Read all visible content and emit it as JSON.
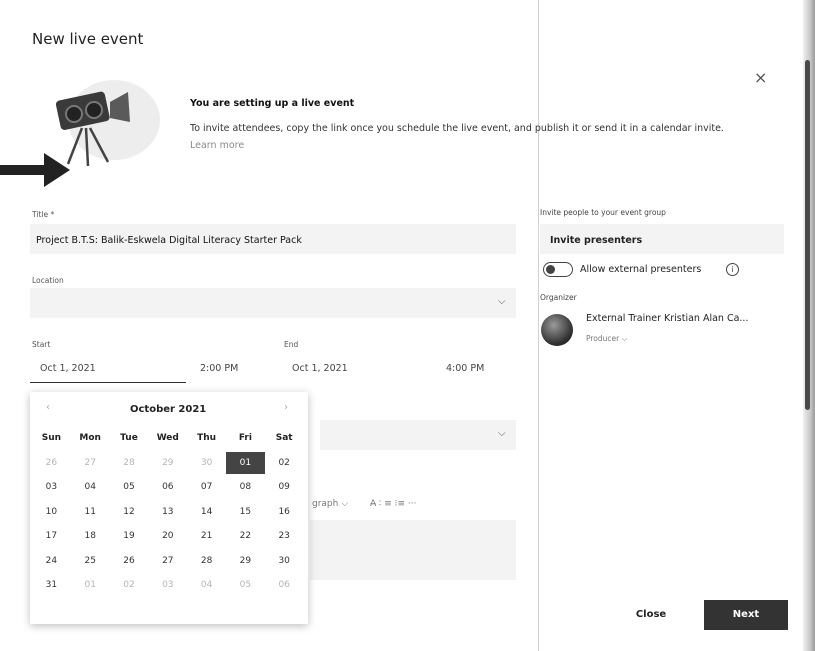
{
  "dialog": {
    "title": "New live event",
    "close_glyph": "×"
  },
  "info": {
    "heading": "You are setting up a live event",
    "body": "To invite attendees, copy the link once you schedule the live event, and publish it or send it in a calendar invite.",
    "link": "Learn more"
  },
  "form": {
    "title_label": "Title *",
    "title_value": "Project B.T.S: Balik-Eskwela Digital Literacy Starter Pack",
    "location_label": "Location",
    "location_value": "",
    "start_label": "Start",
    "end_label": "End",
    "start_date": "Oct 1, 2021",
    "start_time": "2:00 PM",
    "end_date": "Oct 1, 2021",
    "end_time": "4:00 PM",
    "toolbar_paragraph": "graph ⌵",
    "toolbar_glyphs": "A̶ ∶ ≡  ⁝≡  ···"
  },
  "calendar": {
    "month_label": "October 2021",
    "prev_glyph": "‹",
    "next_glyph": "›",
    "weekdays": [
      "Sun",
      "Mon",
      "Tue",
      "Wed",
      "Thu",
      "Fri",
      "Sat"
    ],
    "weeks": [
      [
        "26",
        "27",
        "28",
        "29",
        "30",
        "01",
        "02"
      ],
      [
        "03",
        "04",
        "05",
        "06",
        "07",
        "08",
        "09"
      ],
      [
        "10",
        "11",
        "12",
        "13",
        "14",
        "15",
        "16"
      ],
      [
        "17",
        "18",
        "19",
        "20",
        "21",
        "22",
        "23"
      ],
      [
        "24",
        "25",
        "26",
        "27",
        "28",
        "29",
        "30"
      ],
      [
        "31",
        "01",
        "02",
        "03",
        "04",
        "05",
        "06"
      ]
    ],
    "selected": "01"
  },
  "right_panel": {
    "invite_label": "Invite people to your event group",
    "invite_value": "Invite presenters",
    "toggle_label": "Allow external presenters",
    "toggle_on": false,
    "info_glyph": "i",
    "organizer_label": "Organizer",
    "organizer_name": "External Trainer Kristian Alan Ca...",
    "organizer_role": "Producer ⌵"
  },
  "buttons": {
    "close": "Close",
    "next": "Next"
  },
  "icons": {
    "close": "close-icon",
    "chevron": "chevron-down-icon",
    "info": "info-icon",
    "camera": "video-camera-icon",
    "arrow": "arrow-right-icon"
  },
  "colors": {
    "primary_button": "#333333",
    "selected_day": "#444444",
    "field_background": "#f3f3f3"
  }
}
